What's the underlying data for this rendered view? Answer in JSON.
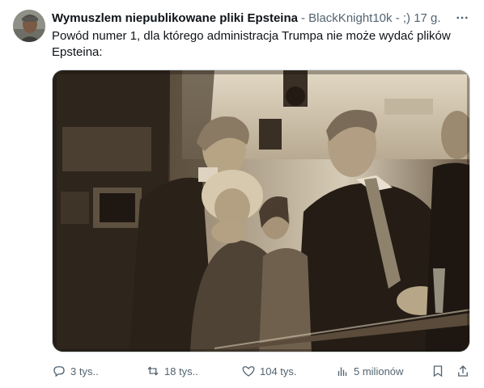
{
  "tweet": {
    "author_name": "Wymuszlem niepublikowane pliki Epsteina",
    "meta_line": "- BlackKnight10k - ;) 17 g.",
    "text": "Powód numer 1, dla którego administracja Trumpa nie może wydać plików Epsteina:",
    "more_icon": "more-horizontal-icon"
  },
  "media": {
    "kind": "sepia-photo",
    "palette": {
      "dark": "#2a2118",
      "mid": "#7a6a55",
      "light": "#d8ccb6",
      "highlight": "#efe6d4"
    }
  },
  "actions": {
    "replies": {
      "icon": "reply-icon",
      "count": "3 tys.."
    },
    "reposts": {
      "icon": "repost-icon",
      "count": "18 tys.."
    },
    "likes": {
      "icon": "like-icon",
      "count": "104 tys."
    },
    "views": {
      "icon": "views-icon",
      "count": "5 milionów"
    },
    "bookmark": {
      "icon": "bookmark-icon"
    },
    "share": {
      "icon": "share-icon"
    }
  },
  "colors": {
    "text_primary": "#0f1419",
    "text_secondary": "#536471",
    "border": "#cfd9de"
  }
}
